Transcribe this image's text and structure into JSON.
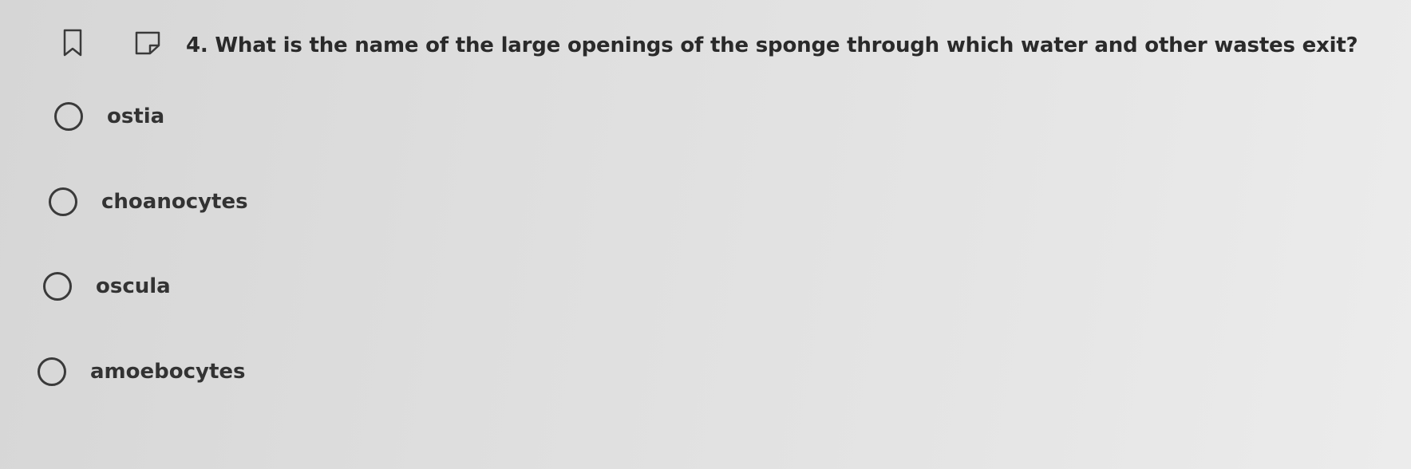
{
  "question": {
    "text": "4. What is the name of the large openings of the sponge through which water and other wastes exit?",
    "icons": [
      "bookmark-icon",
      "flag-icon"
    ]
  },
  "options": [
    {
      "label": "ostia",
      "selected": false
    },
    {
      "label": "choanocytes",
      "selected": false
    },
    {
      "label": "oscula",
      "selected": false
    },
    {
      "label": "amoebocytes",
      "selected": false
    }
  ],
  "colors": {
    "background": "#e0e0e0",
    "text": "#2b2b2b",
    "radio_border": "#3a3a3a"
  }
}
